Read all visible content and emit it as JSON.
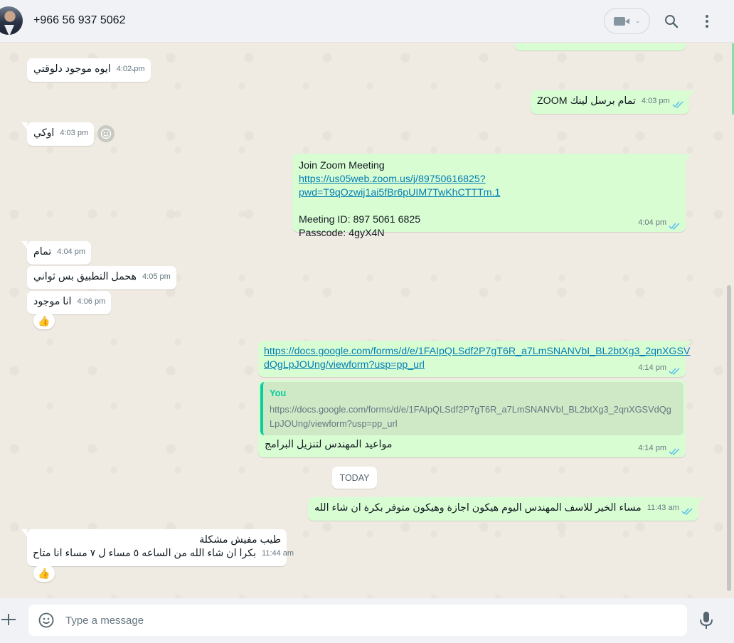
{
  "header": {
    "contact_name": "+966 56 937 5062"
  },
  "messages": {
    "m1": {
      "text": "ايوه موجود دلوقتي",
      "time": "4:02 pm"
    },
    "m2": {
      "text": "تمام برسل لينك ZOOM",
      "time": "4:03 pm"
    },
    "m3": {
      "text": "اوكي",
      "time": "4:03 pm"
    },
    "m4": {
      "line1": "Join Zoom Meeting",
      "link": "https://us05web.zoom.us/j/89750616825?pwd=T9qOzwij1ai5fBr6pUIM7TwKhCTTTm.1",
      "meeting_id": "Meeting ID: 897 5061 6825",
      "passcode": "Passcode: 4gyX4N",
      "time": "4:04 pm"
    },
    "m5": {
      "text": "تمام",
      "time": "4:04 pm"
    },
    "m6": {
      "text": "هحمل التطبيق بس ثواني",
      "time": "4:05 pm"
    },
    "m7": {
      "text": "انا موجود",
      "time": "4:06 pm",
      "reaction": "👍"
    },
    "m8": {
      "link_line1": "https://docs.google.com/forms/d/e/1FAIpQLSdf2P7gT6R_a7LmSNANVbI_BL2btXg3_2qnXGSV",
      "link_line2": "dQgLpJOUng/viewform?usp=pp_url",
      "time": "4:14 pm"
    },
    "m9": {
      "quote_author": "You",
      "quote_line1": "https://docs.google.com/forms/d/e/1FAIpQLSdf2P7gT6R_a7LmSNANVbI_BL2btXg3_2qnXGSVdQg",
      "quote_line2": "LpJOUng/viewform?usp=pp_url",
      "text": "مواعيد المهندس لتنزيل البرامج",
      "time": "4:14 pm"
    },
    "day_chip": "TODAY",
    "m10": {
      "text": "مساء الخير للاسف المهندس اليوم هيكون اجازة وهيكون متوفر بكرة ان شاء الله",
      "time": "11:43 am"
    },
    "m11": {
      "line1": "طيب مفيش مشكلة",
      "line2": "بكرا ان شاء الله من الساعه ٥ مساء ل ٧ مساء انا متاح",
      "time": "11:44 am",
      "reaction": "👍"
    }
  },
  "composer": {
    "placeholder": "Type a message"
  },
  "colors": {
    "outgoing_bubble": "#d9fdd3",
    "incoming_bubble": "#ffffff",
    "read_ticks": "#53bdeb",
    "chat_bg": "#efeae2"
  }
}
